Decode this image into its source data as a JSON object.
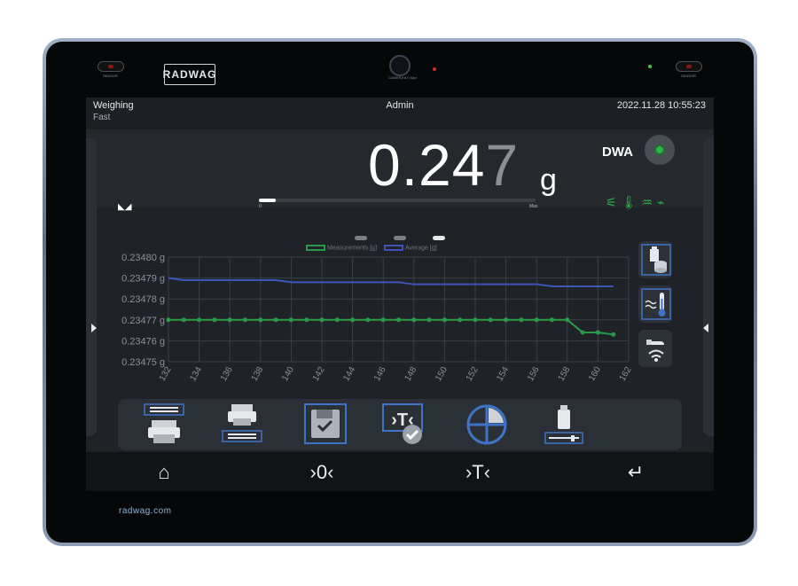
{
  "device": {
    "brand_logo": "RADWAG",
    "brand_url": "radwag.com",
    "sensor_label": "SENSOR",
    "camera_label": "CAMERA 8.0 Mpx"
  },
  "status": {
    "mode": "Weighing",
    "submode": "Fast",
    "user": "Admin",
    "datetime": "2022.11.28 10:55:23"
  },
  "weighing": {
    "value_main": "0.24",
    "value_last_digit": "7",
    "unit": "g",
    "program": "DWA",
    "bargraph_min": "0",
    "bargraph_max": "Max",
    "bargraph_fill": 0.06
  },
  "colors": {
    "accent": "#30b34a",
    "average": "#3d55b8",
    "measurement": "#2b9a48",
    "button_border": "#3f73c8"
  },
  "legend": {
    "measurements": "Measurements [g]",
    "average": "Average [g]"
  },
  "chart_data": {
    "type": "line",
    "x": [
      132,
      133,
      134,
      135,
      136,
      137,
      138,
      139,
      140,
      141,
      142,
      143,
      144,
      145,
      146,
      147,
      148,
      149,
      150,
      151,
      152,
      153,
      154,
      155,
      156,
      157,
      158,
      159,
      160,
      161
    ],
    "series": [
      {
        "name": "Measurements [g]",
        "color": "#2b9a48",
        "values": [
          0.23477,
          0.23477,
          0.23477,
          0.23477,
          0.23477,
          0.23477,
          0.23477,
          0.23477,
          0.23477,
          0.23477,
          0.23477,
          0.23477,
          0.23477,
          0.23477,
          0.23477,
          0.23477,
          0.23477,
          0.23477,
          0.23477,
          0.23477,
          0.23477,
          0.23477,
          0.23477,
          0.23477,
          0.23477,
          0.23477,
          0.23477,
          0.234764,
          0.234764,
          0.234763
        ]
      },
      {
        "name": "Average [g]",
        "color": "#3d55b8",
        "values": [
          0.23479,
          0.234789,
          0.234789,
          0.234789,
          0.234789,
          0.234789,
          0.234789,
          0.234789,
          0.234788,
          0.234788,
          0.234788,
          0.234788,
          0.234788,
          0.234788,
          0.234788,
          0.234788,
          0.234787,
          0.234787,
          0.234787,
          0.234787,
          0.234787,
          0.234787,
          0.234787,
          0.234787,
          0.234787,
          0.234786,
          0.234786,
          0.234786,
          0.234786,
          0.234786
        ]
      }
    ],
    "y_ticks": [
      "0.23480 g",
      "0.23479 g",
      "0.23478 g",
      "0.23477 g",
      "0.23476 g",
      "0.23475 g"
    ],
    "x_ticks": [
      "132",
      "134",
      "136",
      "138",
      "140",
      "142",
      "144",
      "146",
      "148",
      "150",
      "152",
      "154",
      "156",
      "158",
      "160",
      "162"
    ],
    "ylim": [
      0.23475,
      0.2348
    ],
    "xlim": [
      132,
      162
    ],
    "grid": true,
    "legend_position": "top-center"
  }
}
